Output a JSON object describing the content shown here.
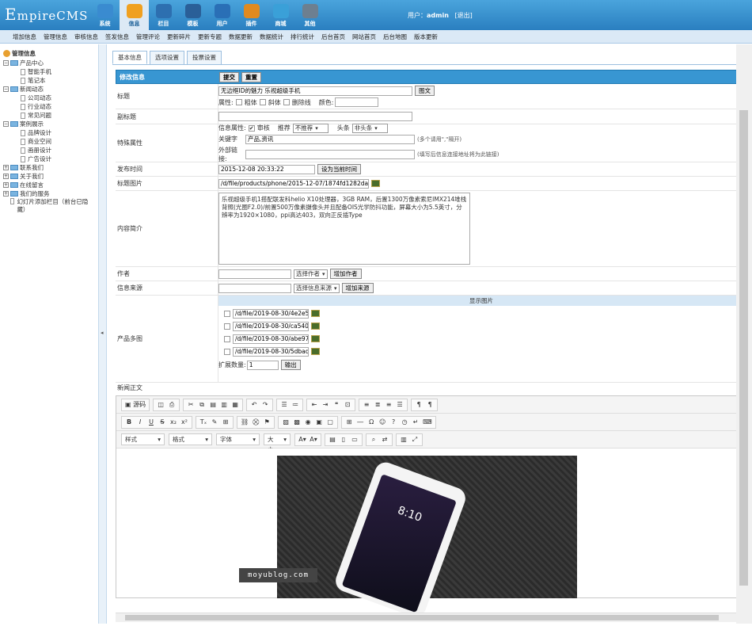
{
  "app": {
    "logo": "EmpireCMS",
    "logo_initial": "E",
    "logo_rest": "mpireCMS"
  },
  "topnav": [
    {
      "label": "系统",
      "icon": "globe-icon",
      "color": "#3a8bd0"
    },
    {
      "label": "信息",
      "icon": "edit-icon",
      "color": "#f0a020",
      "active": true
    },
    {
      "label": "栏目",
      "icon": "folder-icon",
      "color": "#2d6fb0"
    },
    {
      "label": "模板",
      "icon": "template-icon",
      "color": "#2a5f98"
    },
    {
      "label": "用户",
      "icon": "user-icon",
      "color": "#2a6fb6"
    },
    {
      "label": "插件",
      "icon": "plugin-icon",
      "color": "#e08a20"
    },
    {
      "label": "商城",
      "icon": "shop-icon",
      "color": "#3aa0d8"
    },
    {
      "label": "其他",
      "icon": "gear-icon",
      "color": "#6d7f90"
    }
  ],
  "user": {
    "prefix": "用户：",
    "name": "admin",
    "logout": "[退出]"
  },
  "subnav": [
    "增加信息",
    "管理信息",
    "审核信息",
    "签发信息",
    "管理评论",
    "更新碎片",
    "更新专题",
    "数据更新",
    "数据统计",
    "排行统计",
    "后台首页",
    "网站首页",
    "后台地图",
    "版本更新"
  ],
  "sidebar": {
    "title": "管理信息",
    "tree": [
      {
        "label": "产品中心",
        "level": 1,
        "sign": "−"
      },
      {
        "label": "智能手机",
        "level": 2
      },
      {
        "label": "笔记本",
        "level": 2
      },
      {
        "label": "新闻动态",
        "level": 1,
        "sign": "−"
      },
      {
        "label": "公司动态",
        "level": 2
      },
      {
        "label": "行业动态",
        "level": 2
      },
      {
        "label": "常见问题",
        "level": 2
      },
      {
        "label": "案例展示",
        "level": 1,
        "sign": "−"
      },
      {
        "label": "品牌设计",
        "level": 2
      },
      {
        "label": "商业空间",
        "level": 2
      },
      {
        "label": "画册设计",
        "level": 2
      },
      {
        "label": "广告设计",
        "level": 2
      },
      {
        "label": "联系我们",
        "level": 1,
        "sign": "+"
      },
      {
        "label": "关于我们",
        "level": 1,
        "sign": "+"
      },
      {
        "label": "在线留言",
        "level": 1,
        "sign": "+"
      },
      {
        "label": "我们的服务",
        "level": 1,
        "sign": "+"
      },
      {
        "label": "幻灯片添加栏目（前台已隐藏）",
        "level": 1,
        "sign": ""
      }
    ]
  },
  "tabs": [
    "基本信息",
    "选项设置",
    "投票设置"
  ],
  "form": {
    "head_label": "修改信息",
    "submit": "提交",
    "reset": "重置",
    "title_label": "标题",
    "title_value": "无边框ID的魅力 乐视超级手机",
    "title_btn": "图文",
    "attr_label": "属性:",
    "attr_bold": "粗体",
    "attr_italic": "斜体",
    "attr_strike": "删除线",
    "attr_color": "颜色:",
    "subtitle_label": "副标题",
    "special_label": "特殊属性",
    "info_attr": "信息属性:",
    "audit": "审核",
    "recommend": "推荐",
    "recommend_value": "不推荐",
    "headline": "头条",
    "headline_value": "非头条",
    "keywords_label": "关键字",
    "keywords_value": "产品,资讯",
    "keywords_hint": "(多个请用\",\"隔开)",
    "external_label": "外部链接:",
    "external_hint": "(填写后信息连接地址将为此链接)",
    "date_label": "发布时间",
    "date_value": "2015-12-08 20:33:22",
    "date_btn": "设为当前时间",
    "pic_label": "标题图片",
    "pic_value": "/d/file/products/phone/2015-12-07/1874fd1282dad260",
    "summary_label": "内容简介",
    "summary_value": "乐视超级手机1搭配联发科helio X10处理器，3GB RAM，后置1300万像素索尼IMX214堆栈背照(光圈F2.0)/前置500万像素摄像头并且配备OIS光学防抖功能，屏幕大小为5.5英寸，分辨率为1920×1080，ppi高达403，双向正反插Type",
    "author_label": "作者",
    "author_select": "选择作者",
    "author_btn": "增加作者",
    "source_label": "信息来源",
    "source_select": "选择信息来源",
    "source_btn": "增加来源",
    "gallery_label": "产品多图",
    "gallery_head": "显示图片",
    "gallery_files": [
      "/d/file/2019-08-30/4e2e5el",
      "/d/file/2019-08-30/ca5402f",
      "/d/file/2019-08-30/abe97ea",
      "/d/file/2019-08-30/5dbad7"
    ],
    "expand_label": "扩展数量:",
    "expand_value": "1",
    "expand_btn": "输出",
    "body_label": "新闻正文"
  },
  "editor": {
    "source": "源码",
    "style_sel": "样式",
    "format_sel": "格式",
    "font_sel": "字体",
    "size_sel": "大小",
    "phone_time": "8:10"
  },
  "watermark": "moyublog.com"
}
